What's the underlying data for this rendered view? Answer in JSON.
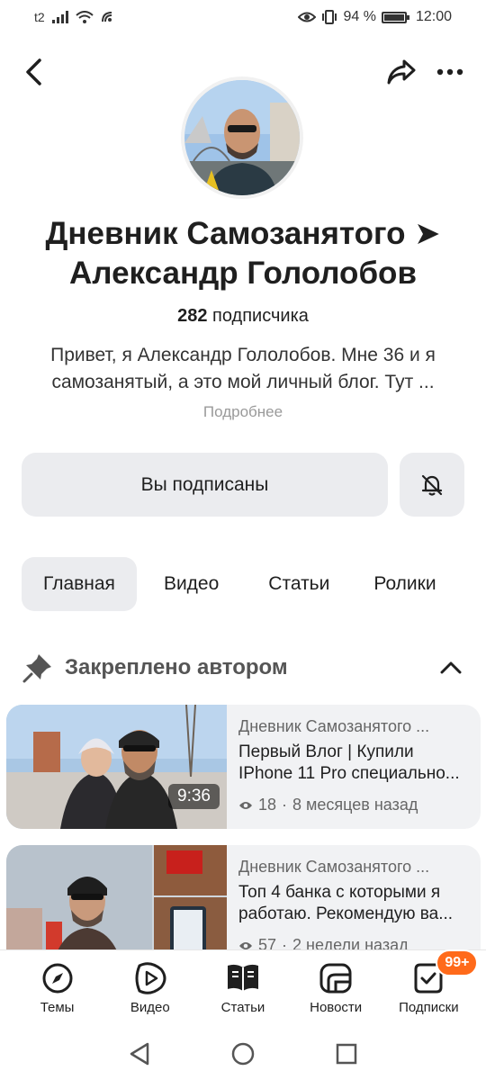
{
  "status_bar": {
    "carrier": "t2",
    "battery_percent": "94 %",
    "time": "12:00"
  },
  "channel": {
    "title": "Дневник Самозанятого ➤ Александр Гололобов",
    "subscribers_count": "282",
    "subscribers_label": "подписчика",
    "description": "Привет, я Александр Гололобов. Мне 36 и я самозанятый, а это мой личный блог. Тут ...",
    "more_label": "Подробнее"
  },
  "actions": {
    "subscribed_label": "Вы подписаны"
  },
  "tabs": [
    {
      "label": "Главная",
      "active": true
    },
    {
      "label": "Видео",
      "active": false
    },
    {
      "label": "Статьи",
      "active": false
    },
    {
      "label": "Ролики",
      "active": false
    }
  ],
  "pinned": {
    "section_label": "Закреплено автором",
    "items": [
      {
        "channel": "Дневник Самозанятого ...",
        "title": "Первый Влог | Купили IPhone 11 Pro специально...",
        "views": "18",
        "age": "8 месяцев назад",
        "duration": "9:36"
      },
      {
        "channel": "Дневник Самозанятого ...",
        "title": "Топ 4 банка с которыми я работаю. Рекомендую ва...",
        "views": "57",
        "age": "2 недели назад"
      }
    ]
  },
  "bottom_nav": [
    {
      "label": "Темы",
      "icon": "compass-icon"
    },
    {
      "label": "Видео",
      "icon": "play-icon"
    },
    {
      "label": "Статьи",
      "icon": "book-icon"
    },
    {
      "label": "Новости",
      "icon": "news-icon"
    },
    {
      "label": "Подписки",
      "icon": "subscriptions-icon",
      "badge": "99+"
    }
  ],
  "colors": {
    "accent_badge": "#ff6a1a",
    "button_bg": "#ebecef",
    "card_bg": "#f1f2f4"
  }
}
